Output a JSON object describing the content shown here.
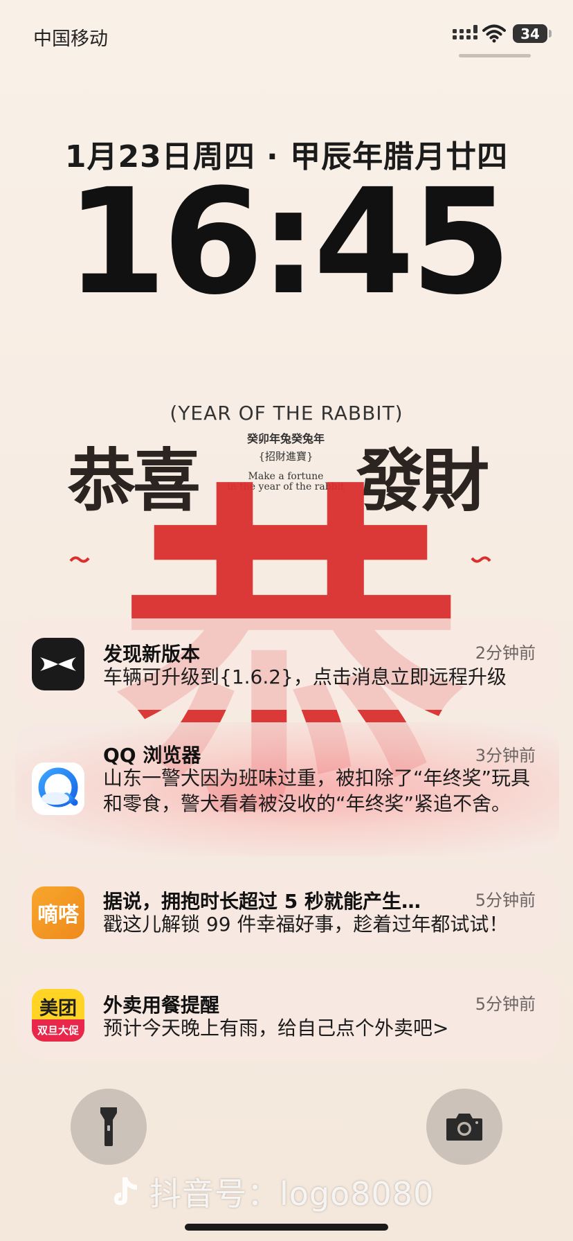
{
  "status_bar": {
    "carrier": "中国移动",
    "battery": "34"
  },
  "lock_screen": {
    "date": "1月23日周四 · 甲辰年腊月廿四",
    "time": "16:45"
  },
  "wallpaper": {
    "subtitle": "(YEAR OF THE RABBIT)",
    "blessing_left": "恭喜",
    "blessing_right": "發財",
    "seal_line1": "癸卯年兔癸兔年",
    "seal_line2": "{招財進寶}",
    "seal_en1": "Make a fortune",
    "seal_en2": "in the year of the rabbit",
    "big_glyph": "恭"
  },
  "notifications": [
    {
      "app_icon": "xpeng-icon",
      "title": "发现新版本",
      "time": "2分钟前",
      "body": "车辆可升级到{1.6.2}，点击消息立即远程升级"
    },
    {
      "app_icon": "qq-browser-icon",
      "title": "QQ 浏览器",
      "time": "3分钟前",
      "body": "山东一警犬因为班味过重，被扣除了“年终奖”玩具和零食，警犬看着被没收的“年终奖”紧追不舍。"
    },
    {
      "app_icon": "dida-icon",
      "icon_text": "嘀嗒",
      "title": "据说，拥抱时长超过 5 秒就能产生…",
      "time": "5分钟前",
      "body": "戳这儿解锁 99 件幸福好事，趁着过年都试试！"
    },
    {
      "app_icon": "meituan-icon",
      "icon_text_top": "美团",
      "icon_text_band": "双旦大促",
      "title": "外卖用餐提醒",
      "time": "5分钟前",
      "body": "预计今天晚上有雨，给自己点个外卖吧>"
    }
  ],
  "watermark": {
    "text": "抖音号：logo8080"
  },
  "colors": {
    "accent_red": "#d9302f",
    "meituan_yellow": "#ffd424",
    "dida_orange": "#f8a62c"
  }
}
